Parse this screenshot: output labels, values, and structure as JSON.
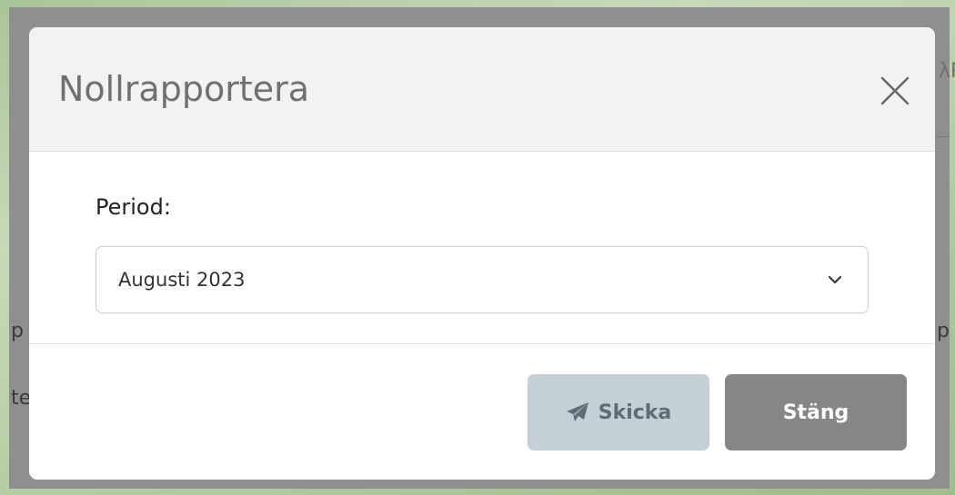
{
  "backdrop": {
    "fragment_right_top": "λP",
    "fragment_left_mid": "p",
    "fragment_right_mid": "p",
    "fragment_left_low": "te"
  },
  "modal": {
    "title": "Nollrapportera",
    "close_icon": "close-icon",
    "period_label": "Period:",
    "period_selected": "Augusti 2023",
    "send_label": "Skicka",
    "send_icon": "paper-plane-icon",
    "close_label": "Stäng"
  }
}
